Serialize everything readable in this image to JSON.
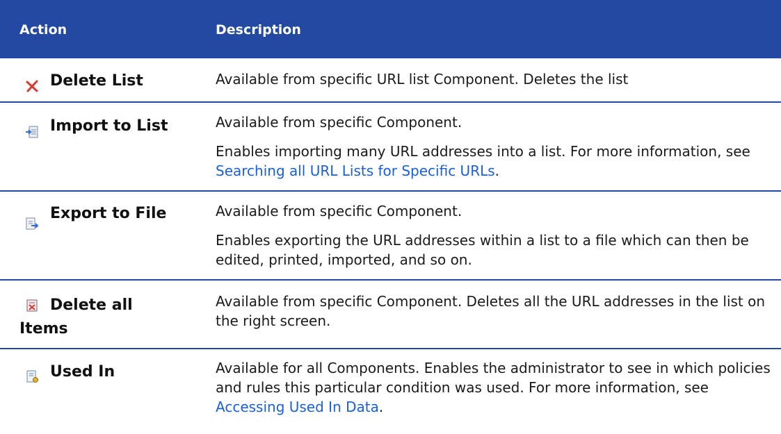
{
  "header": {
    "col_action": "Action",
    "col_description": "Description"
  },
  "rows": [
    {
      "icon": "delete-x-icon",
      "action": "Delete List",
      "paragraphs": [
        {
          "text": "Available from specific URL list Component. Deletes the list"
        }
      ]
    },
    {
      "icon": "import-icon",
      "action": "Import to List",
      "paragraphs": [
        {
          "text": "Available from specific Component."
        },
        {
          "text": "Enables importing many URL addresses into a list. For more information, see ",
          "link": "Searching all URL Lists for Specific URLs",
          "after": "."
        }
      ]
    },
    {
      "icon": "export-icon",
      "action": "Export to File",
      "paragraphs": [
        {
          "text": "Available from specific Component."
        },
        {
          "text": "Enables exporting the URL addresses within a list to a file which can then be edited, printed, imported, and so on."
        }
      ]
    },
    {
      "icon": "delete-items-icon",
      "action_line1": "Delete all",
      "action_line2": "Items",
      "paragraphs": [
        {
          "text": "Available from specific Component. Deletes all the URL addresses in the list on the right screen."
        }
      ]
    },
    {
      "icon": "used-in-icon",
      "action": "Used In",
      "paragraphs": [
        {
          "text": "Available for all Components. Enables the administrator to see in which policies and rules this particular condition was used. For more information, see ",
          "link": "Accessing Used In Data",
          "after": "."
        }
      ]
    }
  ],
  "colors": {
    "header_bg": "#2349a3",
    "link": "#1a5fd8",
    "divider": "#2349a3"
  }
}
